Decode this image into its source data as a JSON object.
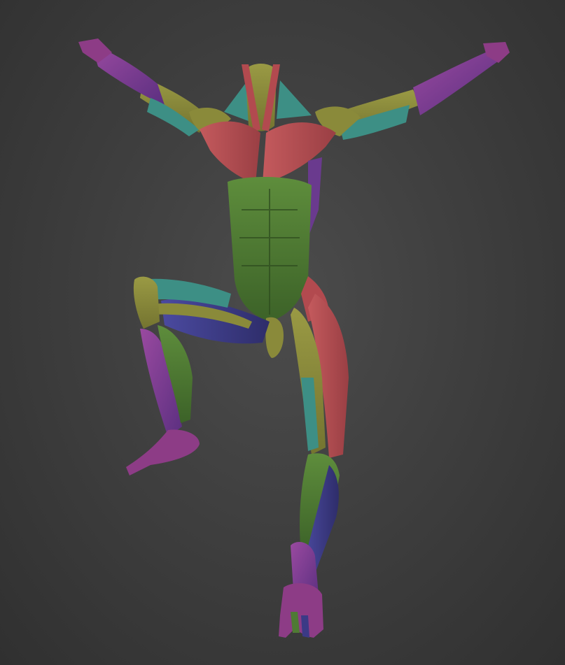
{
  "viewport": {
    "background_color": "#3c3c3c"
  },
  "model": {
    "colors": {
      "green": "#4f7a34",
      "green_dark": "#3a5f27",
      "olive": "#8a8a3a",
      "red": "#b24a4f",
      "red_dark": "#8e3a3e",
      "teal": "#3d8f85",
      "purple": "#6a3a8e",
      "magenta": "#8d3c86",
      "navy": "#3b3a86"
    }
  }
}
